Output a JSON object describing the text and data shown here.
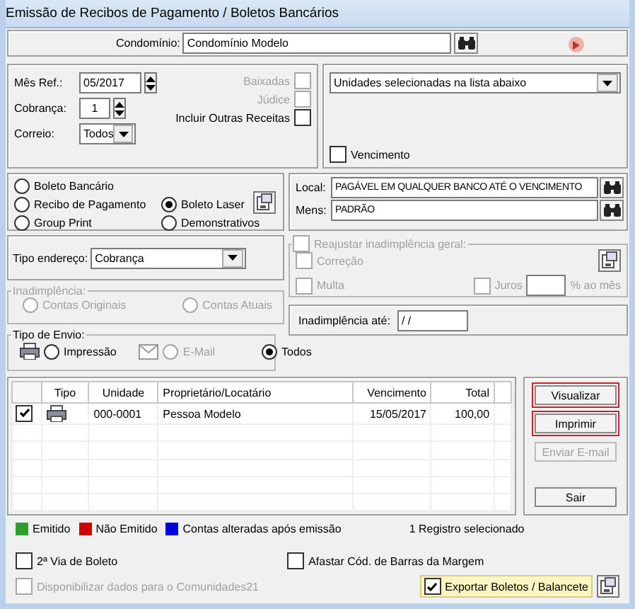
{
  "window": {
    "title": "Emissão de Recibos de Pagamento / Boletos Bancários"
  },
  "condominio": {
    "label": "Condomínio:",
    "value": "Condomínio Modelo"
  },
  "filters": {
    "mes_ref": {
      "label": "Mês Ref.:",
      "value": "05/2017"
    },
    "cobranca": {
      "label": "Cobrança:",
      "value": "1"
    },
    "correio": {
      "label": "Correio:",
      "value": "Todos"
    },
    "checks": [
      {
        "label": "Baixadas",
        "checked": false,
        "disabled": true
      },
      {
        "label": "Júdice",
        "checked": false,
        "disabled": true
      },
      {
        "label": "Incluir Outras Receitas",
        "checked": false,
        "disabled": false
      }
    ]
  },
  "selection": {
    "value": "Unidades selecionadas na lista abaixo",
    "vencimento": {
      "label": "Vencimento",
      "checked": false
    }
  },
  "document_types": [
    {
      "label": "Boleto Bancário",
      "selected": false
    },
    {
      "label": "Recibo de Pagamento",
      "selected": false
    },
    {
      "label": "Boleto Laser",
      "selected": true
    },
    {
      "label": "Group Print",
      "selected": false
    },
    {
      "label": "Demonstrativos",
      "selected": false
    }
  ],
  "local": {
    "label": "Local:",
    "value": "PAGÁVEL EM QUALQUER BANCO ATÉ O VENCIMENTO"
  },
  "mens": {
    "label": "Mens:",
    "value": "PADRÃO"
  },
  "tipo_endereco": {
    "label": "Tipo endereço:",
    "value": "Cobrança"
  },
  "reajustar": {
    "label": "Reajustar inadimplência geral:",
    "checked": false,
    "disabled": true,
    "options": [
      {
        "label": "Correção",
        "checked": false
      },
      {
        "label": "Multa",
        "checked": false
      },
      {
        "label": "Juros",
        "checked": false
      }
    ],
    "unit": "% ao mês"
  },
  "inadimplencia": {
    "title": "Inadimplência:",
    "disabled": true,
    "options": [
      {
        "label": "Contas Originais",
        "selected": false
      },
      {
        "label": "Contas Atuais",
        "selected": false
      }
    ]
  },
  "inadimplencia_ate": {
    "label": "Inadimplência até:",
    "value": "/ /"
  },
  "tipo_envio": {
    "title": "Tipo de Envio:",
    "options": [
      {
        "label": "Impressão",
        "selected": false,
        "disabled": false
      },
      {
        "label": "E-Mail",
        "selected": false,
        "disabled": true
      },
      {
        "label": "Todos",
        "selected": true,
        "disabled": false
      }
    ]
  },
  "table": {
    "columns": [
      "Tipo",
      "Unidade",
      "Proprietário/Locatário",
      "Vencimento",
      "Total"
    ],
    "rows": [
      {
        "checked": true,
        "unidade": "000-0001",
        "proprietario": "Pessoa Modelo",
        "vencimento": "15/05/2017",
        "total": "100,00"
      }
    ]
  },
  "buttons": [
    {
      "label": "Visualizar",
      "highlighted": true,
      "disabled": false
    },
    {
      "label": "Imprimir",
      "highlighted": true,
      "disabled": false
    },
    {
      "label": "Enviar E-mail",
      "highlighted": false,
      "disabled": true
    },
    {
      "label": "Sair",
      "highlighted": false,
      "disabled": false
    }
  ],
  "legend": [
    {
      "label": "Emitido",
      "color": "#2e9e2e"
    },
    {
      "label": "Não Emitido",
      "color": "#cc0000"
    },
    {
      "label": "Contas alteradas após emissão",
      "color": "#0000dd"
    }
  ],
  "record_count": "1 Registro selecionado",
  "options": [
    {
      "label": "2ª Via de Boleto",
      "checked": false
    },
    {
      "label": "Afastar Cód. de Barras da Margem",
      "checked": false
    }
  ],
  "footer": {
    "disponibilizar": {
      "label": "Disponibilizar dados para o Comunidades21",
      "checked": false,
      "disabled": true
    },
    "exportar": {
      "label": "Exportar Boletos / Balancete",
      "checked": true
    }
  }
}
